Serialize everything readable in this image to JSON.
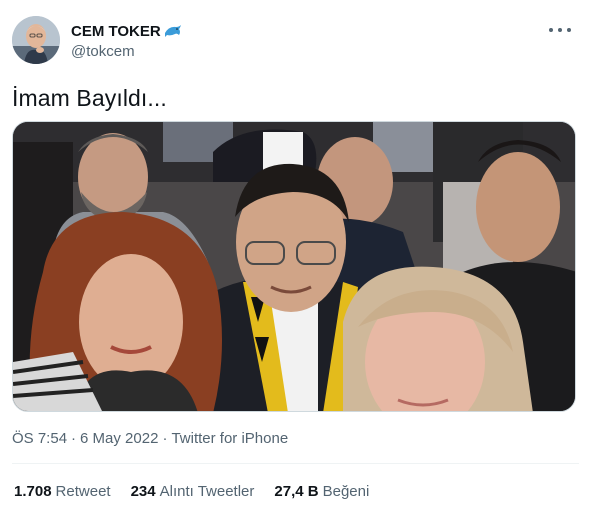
{
  "author": {
    "display_name": "CEM TOKER",
    "handle": "@tokcem",
    "badge_icon": "dolphin-emoji-icon",
    "avatar_icon": "profile-photo"
  },
  "menu": {
    "more_icon": "more-horizontal-icon"
  },
  "tweet": {
    "text": "İmam Bayıldı..."
  },
  "media": {
    "type": "photo"
  },
  "meta": {
    "time": "ÖS 7:54",
    "separator1": "·",
    "date": "6 May 2022",
    "separator2": "·",
    "source": "Twitter for iPhone"
  },
  "stats": [
    {
      "count": "1.708",
      "label": "Retweet"
    },
    {
      "count": "234",
      "label": "Alıntı Tweetler"
    },
    {
      "count": "27,4 B",
      "label": "Beğeni"
    }
  ],
  "colors": {
    "text_primary": "#0f1419",
    "text_secondary": "#536471",
    "border": "#cfd9de",
    "divider": "#eff3f4",
    "badge_blue": "#3b9cd9"
  }
}
